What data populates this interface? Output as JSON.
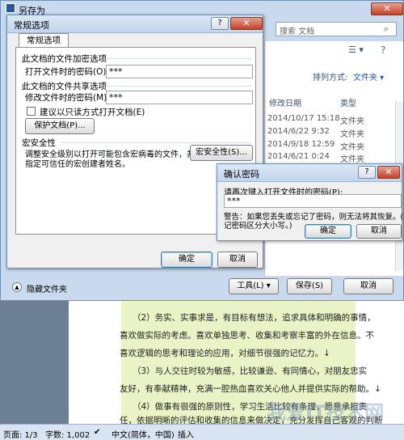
{
  "saveas": {
    "title": "另存为",
    "search_placeholder": "搜索 文档",
    "sort_label": "排列方式:",
    "sort_value": "文件夹 ▾",
    "columns": {
      "modified": "修改日期",
      "type": "类型"
    },
    "rows": [
      {
        "date": "2014/10/17 15:18",
        "type": "文件夹"
      },
      {
        "date": "2014/6/22 9:32",
        "type": "文件夹"
      },
      {
        "date": "2014/9/18 12:59",
        "type": "文件夹"
      },
      {
        "date": "2014/6/21 0:24",
        "type": "文件夹"
      }
    ],
    "hide_folders": "隐藏文件夹",
    "tools_button": "工具(L)",
    "save_button": "保存(S)",
    "cancel_button": "取消"
  },
  "general": {
    "title": "常规选项",
    "tab": "常规选项",
    "encrypt_group": "此文档的文件加密选项",
    "open_password_label": "打开文件时的密码(O):",
    "open_password_value": "***",
    "share_group": "此文档的文件共享选项",
    "modify_password_label": "修改文件时的密码(M):",
    "modify_password_value": "***",
    "readonly_label": "建议以只读方式打开文档(E)",
    "protect_button": "保护文档(P)...",
    "macro_group": "宏安全性",
    "macro_text_1": "调整安全级别以打开可能包含宏病毒的文件，并",
    "macro_text_2": "指定可信任的宏创建者姓名。",
    "macro_button": "宏安全性(S)...",
    "ok_button": "确定",
    "cancel_button": "取消"
  },
  "confirm": {
    "title": "确认密码",
    "prompt": "请再次键入打开文件时的密码(P):",
    "value": "***",
    "warning_1": "警告：如果您丢失或忘记了密码，则无法将其恢复。(切",
    "warning_2": "记密码区分大小写。)",
    "ok_button": "确定",
    "cancel_button": "取消"
  },
  "document": {
    "lines": [
      "（2）务实、实事求是，有目标有想法，追求具体和明确的事情，",
      "喜欢做实际的考虑。喜欢单独思考、收集和考察丰富的外在信息。不",
      "喜欢逻辑的思考和理论的应用，对细节很强的记忆力。↓",
      "（3）与人交往时较为敏感，比较谦逊、有同情心，对朋友忠实",
      "友好，有奉献精神，充满一腔热血喜欢关心他人并提供实际的帮助。↓",
      "（4）做事有很强的原则性，学习生活比较有条理，愿意承担责",
      "任，依据明晰的评估和收集的信息来做决定，充分发挥自己客观的判断"
    ]
  },
  "statusbar": {
    "page": "页面: 1/3",
    "words": "字数: 1,002",
    "language": "中文(简体，中国)",
    "mode": "插入"
  },
  "watermark": "我爱IT技术网"
}
